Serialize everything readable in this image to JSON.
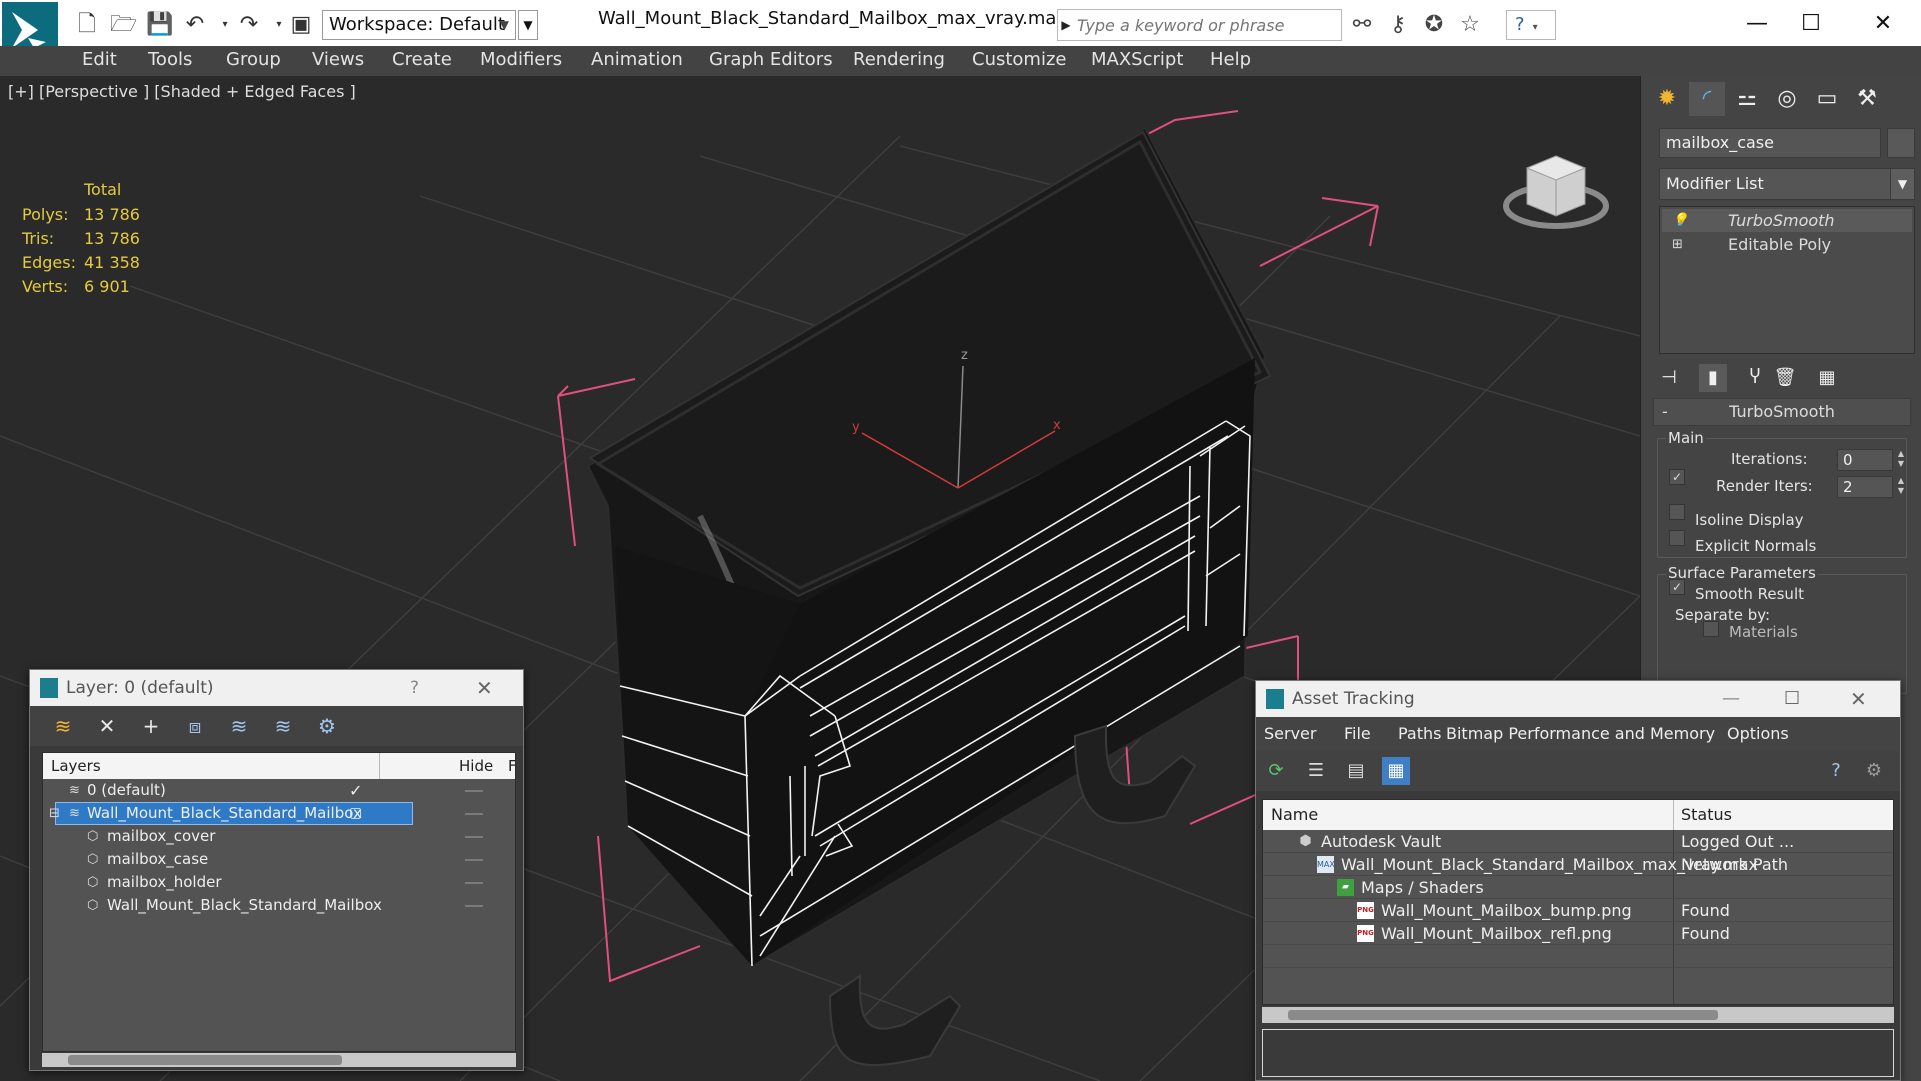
{
  "titlebar": {
    "workspace_label": "Workspace: Default",
    "document_title": "Wall_Mount_Black_Standard_Mailbox_max_vray.max",
    "search_placeholder": "Type a keyword or phrase",
    "help_glyph": "?",
    "icons": [
      "app-logo",
      "new-file-icon",
      "open-folder-icon",
      "save-icon",
      "undo-icon",
      "redo-icon",
      "project-icon",
      "binoculars-icon",
      "key-icon",
      "satellite-icon",
      "star-icon",
      "help-icon",
      "minimize-icon",
      "maximize-icon",
      "close-icon"
    ]
  },
  "menu": [
    "Edit",
    "Tools",
    "Group",
    "Views",
    "Create",
    "Modifiers",
    "Animation",
    "Graph Editors",
    "Rendering",
    "Customize",
    "MAXScript",
    "Help"
  ],
  "viewport": {
    "label": "[+] [Perspective ] [Shaded + Edged Faces ]",
    "stats": {
      "header": "Total",
      "rows": [
        {
          "k": "Polys:",
          "v": "13 786"
        },
        {
          "k": "Tris:",
          "v": "13 786"
        },
        {
          "k": "Edges:",
          "v": "41 358"
        },
        {
          "k": "Verts:",
          "v": "6 901"
        }
      ]
    },
    "axis_labels": {
      "x": "x",
      "y": "y",
      "z": "z"
    },
    "colors": {
      "background": "#2a2a2a",
      "grid": "#3c3c3c",
      "bbox": "#e0507c",
      "wire": "#ffffff",
      "stats": "#e4cb3c"
    }
  },
  "command_panel": {
    "object_name": "mailbox_case",
    "modifier_list_label": "Modifier List",
    "stack": [
      "TurboSmooth",
      "Editable Poly"
    ],
    "rollout_title": "TurboSmooth",
    "main_group": "Main",
    "iterations_label": "Iterations:",
    "iterations_value": "0",
    "render_iters_label": "Render Iters:",
    "render_iters_value": "2",
    "isoline_label": "Isoline Display",
    "explicit_normals_label": "Explicit Normals",
    "surface_group": "Surface Parameters",
    "smooth_result_label": "Smooth Result",
    "separate_by_label": "Separate by:",
    "materials_label": "Materials"
  },
  "layer_dialog": {
    "title": "Layer: 0 (default)",
    "help": "?",
    "col_layers": "Layers",
    "col_hide": "Hide",
    "col_f": "F",
    "rows": [
      {
        "name": "0 (default)",
        "indent": 0
      },
      {
        "name": "Wall_Mount_Black_Standard_Mailbox",
        "indent": 0
      },
      {
        "name": "mailbox_cover",
        "indent": 1
      },
      {
        "name": "mailbox_case",
        "indent": 1
      },
      {
        "name": "mailbox_holder",
        "indent": 1
      },
      {
        "name": "Wall_Mount_Black_Standard_Mailbox",
        "indent": 1
      }
    ]
  },
  "asset_dialog": {
    "title": "Asset Tracking",
    "menu": [
      "Server",
      "File",
      "Paths",
      "Bitmap Performance and Memory",
      "Options"
    ],
    "col_name": "Name",
    "col_status": "Status",
    "rows": [
      {
        "name": "Autodesk Vault",
        "status": "Logged Out ..."
      },
      {
        "name": "Wall_Mount_Black_Standard_Mailbox_max_vray.max",
        "status": "Network Path"
      },
      {
        "name": "Maps / Shaders",
        "status": ""
      },
      {
        "name": "Wall_Mount_Mailbox_bump.png",
        "status": "Found"
      },
      {
        "name": "Wall_Mount_Mailbox_refl.png",
        "status": "Found"
      }
    ],
    "png_badge": "PNG"
  }
}
